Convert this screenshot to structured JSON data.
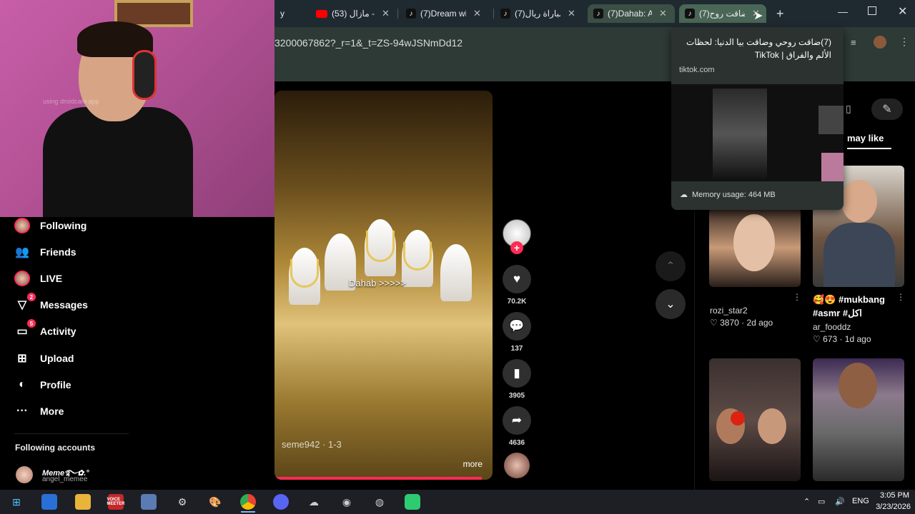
{
  "browser": {
    "tabs": [
      {
        "title": "y",
        "icon": "tiktok-icon"
      },
      {
        "title": "(53) مازال - L",
        "icon": "youtube-icon"
      },
      {
        "title": "(7)Dream wi",
        "icon": "tiktok-icon"
      },
      {
        "title": "(7)مباراة ريال",
        "icon": "tiktok-icon"
      },
      {
        "title": "(7)Dahab: A",
        "icon": "tiktok-icon"
      },
      {
        "title": "(7)ضاقت روح",
        "icon": "tiktok-icon"
      }
    ],
    "url": "3200067862?_r=1&_t=ZS-94wJSNmDd12",
    "hover_card": {
      "title": "(7)ضاقت روحي وضاقت بيا الدنيا: لحظات الألم والفراق | TikTok",
      "domain": "tiktok.com",
      "memory": "Memory usage: 464 MB"
    }
  },
  "webcam": {
    "watermark": "using droidcam app"
  },
  "sidebar": {
    "items": [
      {
        "label": "Following",
        "icon": "following-avatar-icon"
      },
      {
        "label": "Friends",
        "icon": "friends-icon"
      },
      {
        "label": "LIVE",
        "icon": "live-icon"
      },
      {
        "label": "Messages",
        "icon": "messages-icon",
        "badge": "2"
      },
      {
        "label": "Activity",
        "icon": "activity-icon",
        "badge": "5"
      },
      {
        "label": "Upload",
        "icon": "upload-icon"
      },
      {
        "label": "Profile",
        "icon": "profile-icon"
      },
      {
        "label": "More",
        "icon": "more-icon"
      }
    ],
    "following_title": "Following accounts",
    "account": {
      "name": "Meme࿐✿.°",
      "handle": "angel_memee"
    }
  },
  "video": {
    "caption": "Dahab >>>>>",
    "author": "seme942 · 1-3",
    "more": "more",
    "progress": 0.95,
    "likes": "70.2K",
    "comments": "137",
    "saves": "3905",
    "shares": "4636"
  },
  "right_panel": {
    "may_like": "may like",
    "cards": [
      {
        "title": "",
        "user": "rozi_star2",
        "likes": "3870",
        "age": "2d ago"
      },
      {
        "title": "🥰😍 #mukbang #asmr #اكل",
        "user": "ar_fooddz",
        "likes": "673",
        "age": "1d ago"
      }
    ]
  },
  "taskbar": {
    "lang": "ENG",
    "time": "3:05 PM",
    "date": "3/23/2026",
    "voice_label": "VOICE MEETER"
  },
  "colors": {
    "accent": "#fe2c55",
    "tab_active": "#3b4f44",
    "taskbar": "#1d1f25"
  }
}
